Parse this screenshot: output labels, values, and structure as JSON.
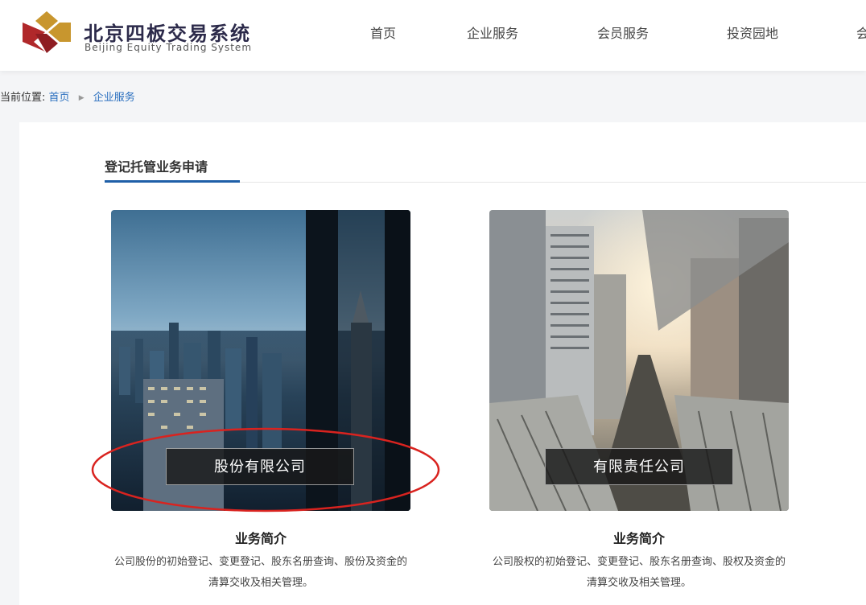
{
  "header": {
    "brand_cn": "北京四板交易系统",
    "brand_en": "Beijing Equity Trading System",
    "nav": [
      {
        "label": "首页"
      },
      {
        "label": "企业服务"
      },
      {
        "label": "会员服务"
      },
      {
        "label": "投资园地"
      },
      {
        "label": "会"
      }
    ]
  },
  "breadcrumb": {
    "prefix": "当前位置:",
    "items": [
      "首页",
      "企业服务"
    ]
  },
  "section": {
    "title": "登记托管业务申请"
  },
  "cards": [
    {
      "label": "股份有限公司",
      "intro_title": "业务简介",
      "intro_desc": "公司股份的初始登记、变更登记、股东名册查询、股份及资金的清算交收及相关管理。"
    },
    {
      "label": "有限责任公司",
      "intro_title": "业务简介",
      "intro_desc": "公司股权的初始登记、变更登记、股东名册查询、股权及资金的清算交收及相关管理。"
    }
  ],
  "colors": {
    "accent": "#1f5fa8",
    "link": "#2a6fbf",
    "annotation": "#d9231f",
    "logo_gold": "#c8962e",
    "logo_red": "#b0282a"
  }
}
